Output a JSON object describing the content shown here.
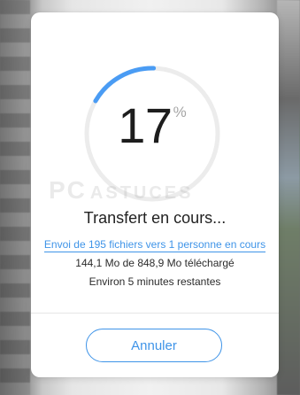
{
  "progress": {
    "value": 17,
    "percent_label": "17",
    "percent_sign": "%",
    "ring_track_color": "#ececec",
    "ring_fill_color": "#4a9cf4"
  },
  "watermark": {
    "primary": "PC",
    "secondary": "ASTUCES"
  },
  "transfer": {
    "title": "Transfert en cours...",
    "link_text": "Envoi de 195 fichiers vers 1 personne en cours",
    "size_text": "144,1 Mo de 848,9 Mo téléchargé",
    "eta_text": "Environ 5 minutes restantes"
  },
  "actions": {
    "cancel_label": "Annuler"
  }
}
